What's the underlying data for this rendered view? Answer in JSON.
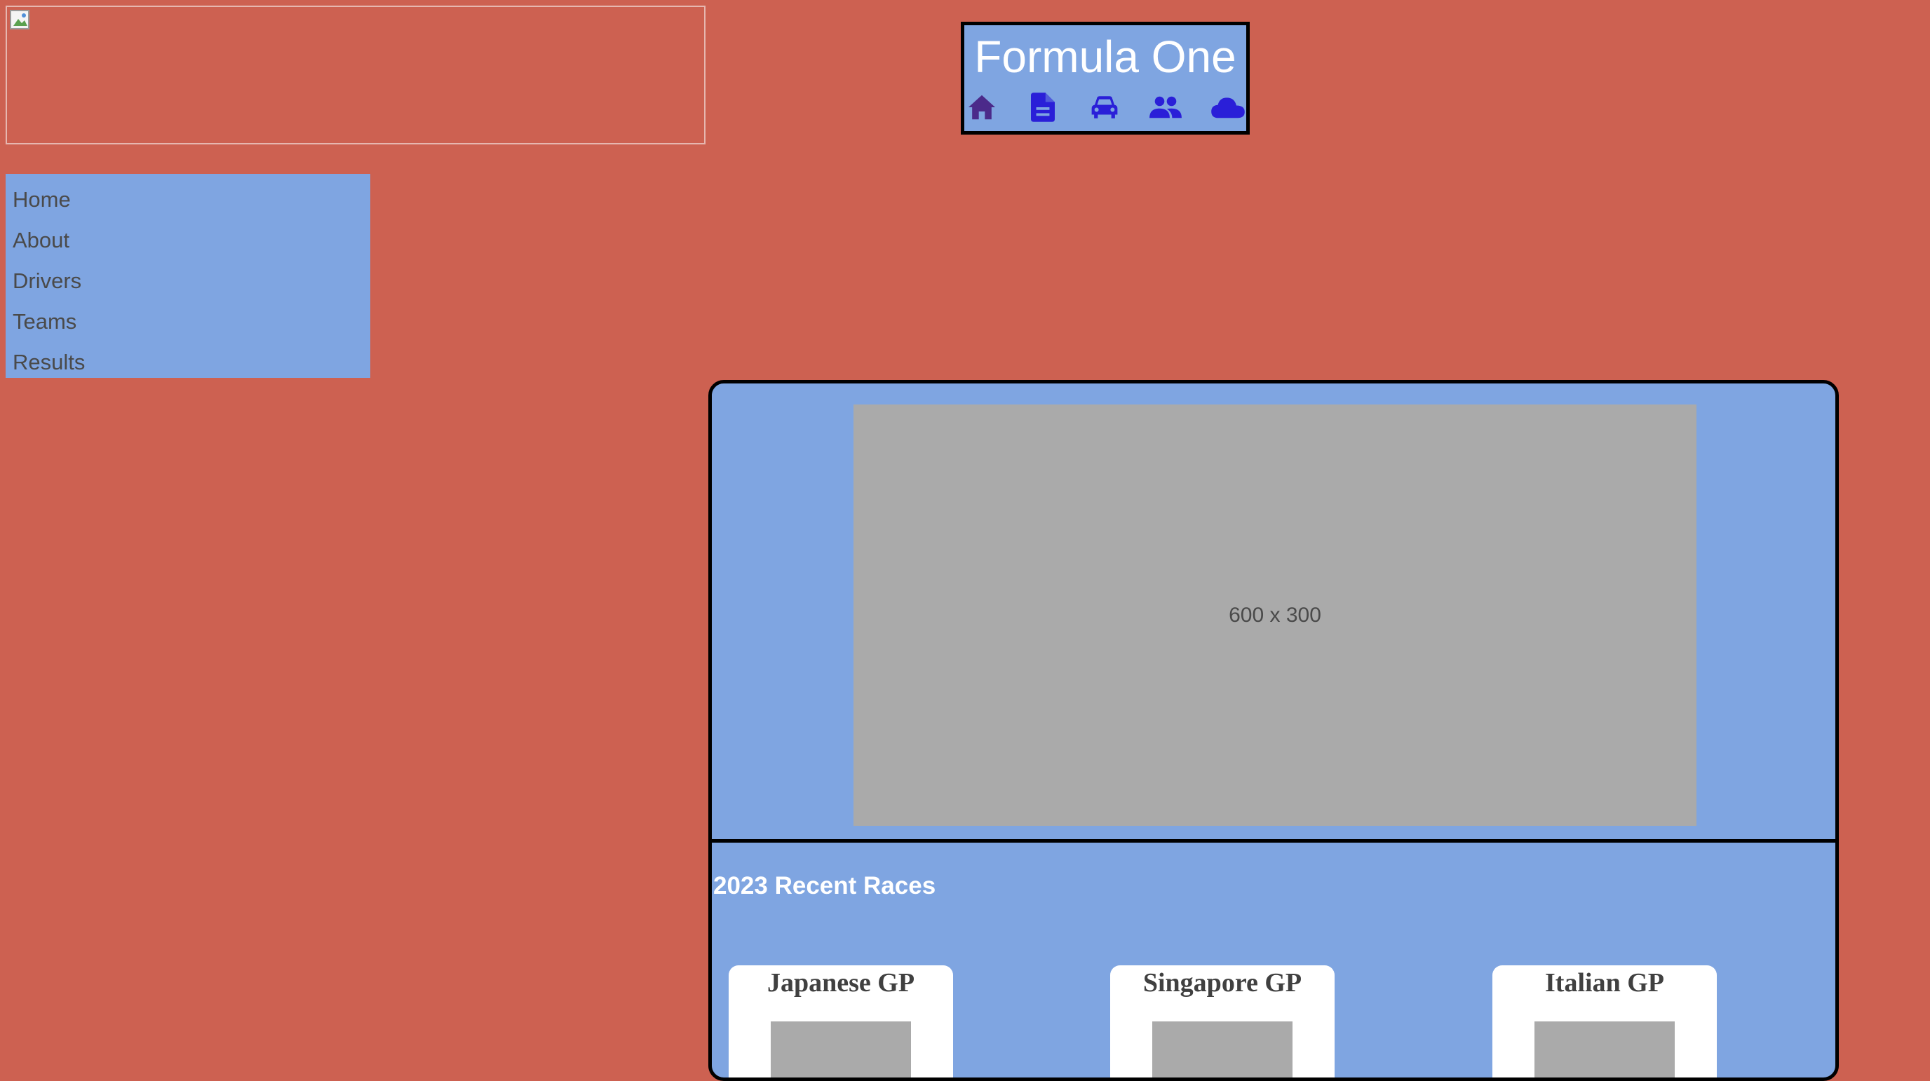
{
  "header": {
    "title": "Formula One",
    "icons": [
      {
        "name": "home-icon",
        "color": "#4b2a8a"
      },
      {
        "name": "document-icon",
        "color": "#2a1fd8"
      },
      {
        "name": "car-icon",
        "color": "#2a1fd8"
      },
      {
        "name": "people-icon",
        "color": "#2a1fd8"
      },
      {
        "name": "cloud-icon",
        "color": "#2a1fd8"
      }
    ]
  },
  "sidebar": {
    "items": [
      {
        "label": "Home"
      },
      {
        "label": "About"
      },
      {
        "label": "Drivers"
      },
      {
        "label": "Teams"
      },
      {
        "label": "Results"
      }
    ]
  },
  "hero": {
    "placeholder_text": "600 x 300"
  },
  "races": {
    "title": "2023 Recent Races",
    "cards": [
      {
        "name": "Japanese GP"
      },
      {
        "name": "Singapore GP"
      },
      {
        "name": "Italian GP"
      }
    ]
  },
  "colors": {
    "background": "#cd6151",
    "panel": "#7fa5e1",
    "placeholder": "#aaaaaa"
  }
}
